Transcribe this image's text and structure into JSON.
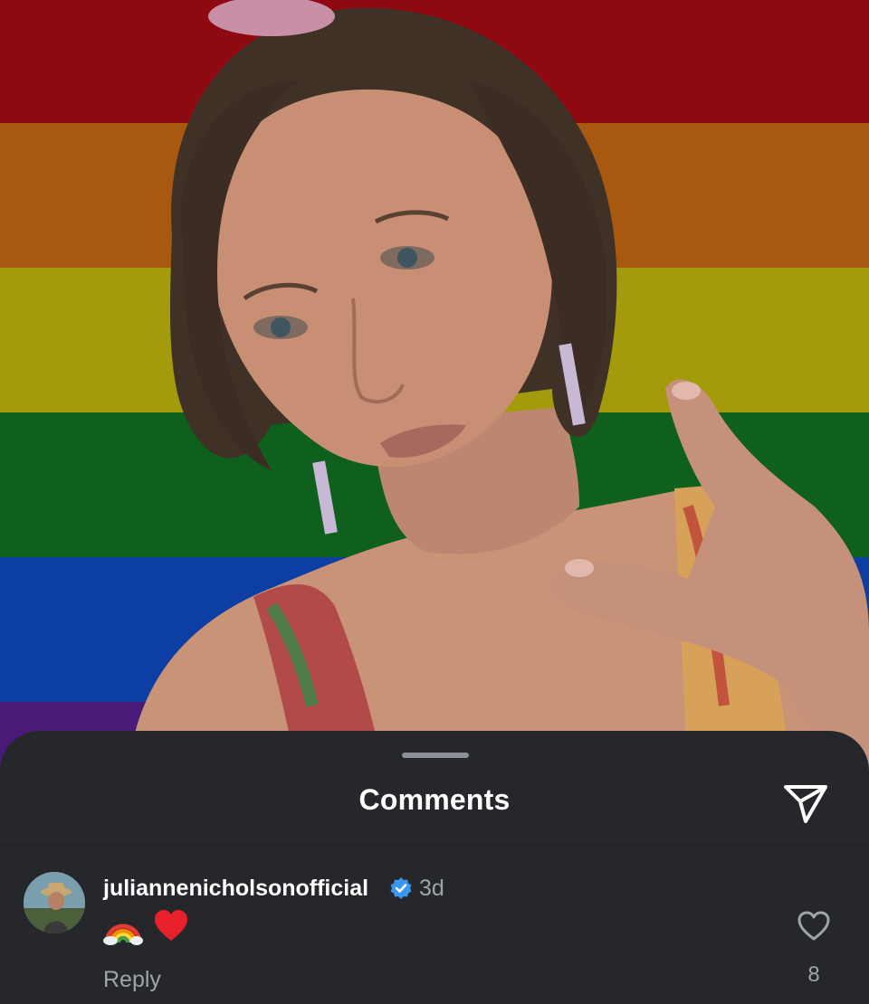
{
  "story": {
    "background": "rainbow-pride-flag",
    "flag_colors": [
      "#8e0a10",
      "#a9590f",
      "#a39b0c",
      "#0f5f1d",
      "#0d3ea4",
      "#4a1a78"
    ]
  },
  "comments_sheet": {
    "title": "Comments",
    "share_icon": "paper-plane-icon",
    "background": "#25272b"
  },
  "comments": [
    {
      "username": "juliannenicholsonofficial",
      "verified": true,
      "time": "3d",
      "emojis": [
        "rainbow-emoji",
        "red-heart-emoji"
      ],
      "reply_label": "Reply",
      "like_icon": "heart-outline-icon",
      "like_count": "8"
    }
  ],
  "colors": {
    "text_primary": "#ffffff",
    "text_secondary": "#a0a4aa",
    "verified_blue": "#3897f0"
  }
}
